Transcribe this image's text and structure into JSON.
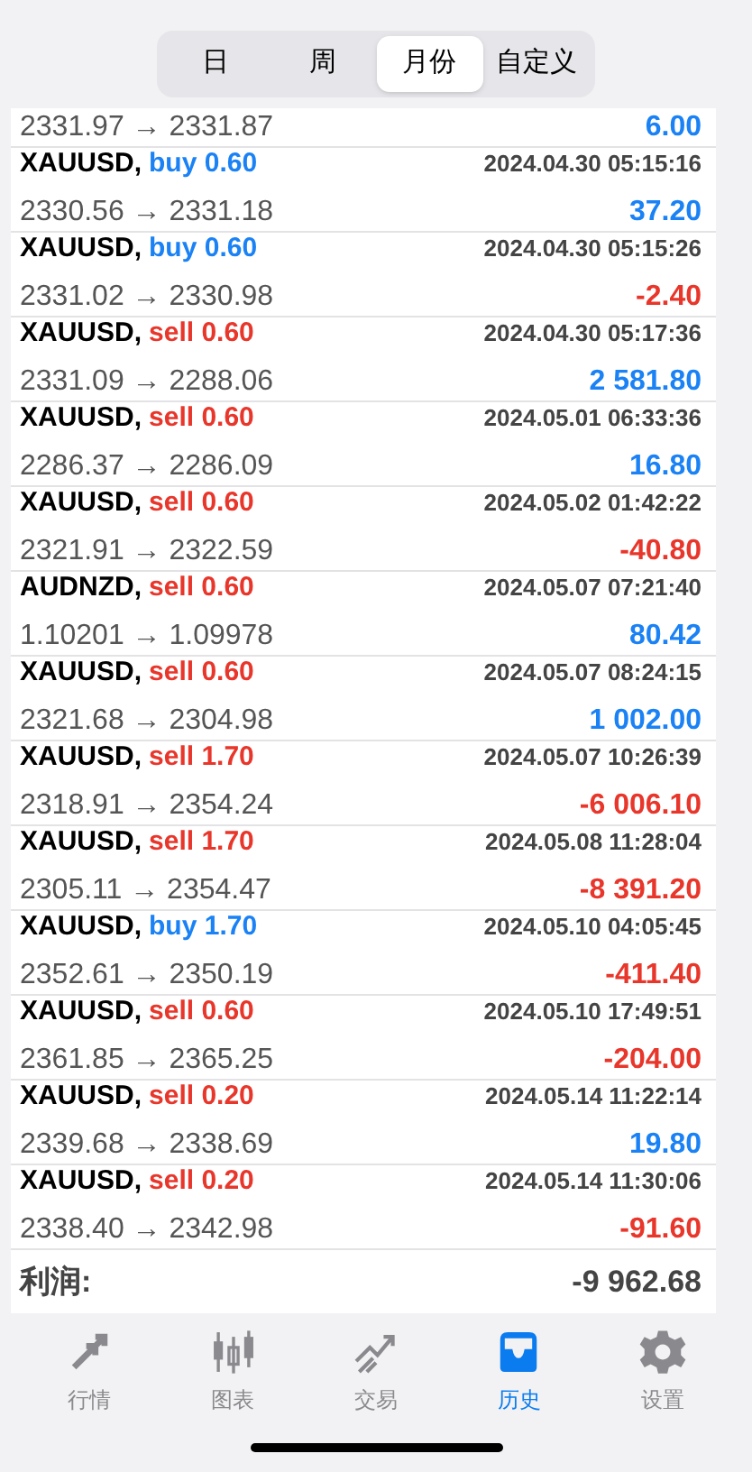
{
  "segments": [
    {
      "label": "日",
      "selected": false
    },
    {
      "label": "周",
      "selected": false
    },
    {
      "label": "月份",
      "selected": true
    },
    {
      "label": "自定义",
      "selected": false
    }
  ],
  "partial_row": {
    "prices": "2331.97 → 2331.87",
    "profit": "6.00",
    "loss": false
  },
  "deals": [
    {
      "symbol": "XAUUSD,",
      "kind": "buy",
      "order": "buy 0.60",
      "time": "2024.04.30 05:15:16",
      "prices": "2330.56 → 2331.18",
      "profit": "37.20",
      "loss": false
    },
    {
      "symbol": "XAUUSD,",
      "kind": "buy",
      "order": "buy 0.60",
      "time": "2024.04.30 05:15:26",
      "prices": "2331.02 → 2330.98",
      "profit": "-2.40",
      "loss": true
    },
    {
      "symbol": "XAUUSD,",
      "kind": "sell",
      "order": "sell 0.60",
      "time": "2024.04.30 05:17:36",
      "prices": "2331.09 → 2288.06",
      "profit": "2 581.80",
      "loss": false
    },
    {
      "symbol": "XAUUSD,",
      "kind": "sell",
      "order": "sell 0.60",
      "time": "2024.05.01 06:33:36",
      "prices": "2286.37 → 2286.09",
      "profit": "16.80",
      "loss": false
    },
    {
      "symbol": "XAUUSD,",
      "kind": "sell",
      "order": "sell 0.60",
      "time": "2024.05.02 01:42:22",
      "prices": "2321.91 → 2322.59",
      "profit": "-40.80",
      "loss": true
    },
    {
      "symbol": "AUDNZD,",
      "kind": "sell",
      "order": "sell 0.60",
      "time": "2024.05.07 07:21:40",
      "prices": "1.10201 → 1.09978",
      "profit": "80.42",
      "loss": false
    },
    {
      "symbol": "XAUUSD,",
      "kind": "sell",
      "order": "sell 0.60",
      "time": "2024.05.07 08:24:15",
      "prices": "2321.68 → 2304.98",
      "profit": "1 002.00",
      "loss": false
    },
    {
      "symbol": "XAUUSD,",
      "kind": "sell",
      "order": "sell 1.70",
      "time": "2024.05.07 10:26:39",
      "prices": "2318.91 → 2354.24",
      "profit": "-6 006.10",
      "loss": true
    },
    {
      "symbol": "XAUUSD,",
      "kind": "sell",
      "order": "sell 1.70",
      "time": "2024.05.08 11:28:04",
      "prices": "2305.11 → 2354.47",
      "profit": "-8 391.20",
      "loss": true
    },
    {
      "symbol": "XAUUSD,",
      "kind": "buy",
      "order": "buy 1.70",
      "time": "2024.05.10 04:05:45",
      "prices": "2352.61 → 2350.19",
      "profit": "-411.40",
      "loss": true
    },
    {
      "symbol": "XAUUSD,",
      "kind": "sell",
      "order": "sell 0.60",
      "time": "2024.05.10 17:49:51",
      "prices": "2361.85 → 2365.25",
      "profit": "-204.00",
      "loss": true
    },
    {
      "symbol": "XAUUSD,",
      "kind": "sell",
      "order": "sell 0.20",
      "time": "2024.05.14 11:22:14",
      "prices": "2339.68 → 2338.69",
      "profit": "19.80",
      "loss": false
    },
    {
      "symbol": "XAUUSD,",
      "kind": "sell",
      "order": "sell 0.20",
      "time": "2024.05.14 11:30:06",
      "prices": "2338.40 → 2342.98",
      "profit": "-91.60",
      "loss": true
    }
  ],
  "summary": {
    "label": "利润:",
    "value": "-9 962.68"
  },
  "tab_bar": [
    {
      "kind": "quotes",
      "label": "行情",
      "selected": false
    },
    {
      "kind": "chart",
      "label": "图表",
      "selected": false
    },
    {
      "kind": "trade",
      "label": "交易",
      "selected": false
    },
    {
      "kind": "history",
      "label": "历史",
      "selected": true
    },
    {
      "kind": "settings",
      "label": "设置",
      "selected": false
    }
  ]
}
